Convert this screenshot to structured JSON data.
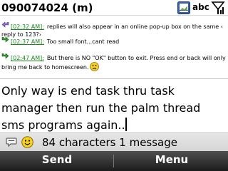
{
  "header": {
    "title": "090074024 (m)",
    "mode_indicator": "abc"
  },
  "history": {
    "messages": [
      {
        "time": "[02:32 AM]:",
        "text": "replies will also appear in an online pop-up box on the same ‹ reply to 123?›",
        "direction": "incoming",
        "arrow_icon": "incoming-arrow-icon"
      },
      {
        "time": "[02:37 AM]:",
        "text": "Too small font...cant read",
        "direction": "outgoing",
        "arrow_icon": "outgoing-arrow-icon"
      },
      {
        "time": "[02:47 AM]:",
        "text": "But there is NO \"OK\" button to exit. Press end or back will only bring me back to homescreen.",
        "direction": "outgoing",
        "arrow_icon": "outgoing-arrow-icon",
        "trailing_icon": "frown-icon"
      }
    ]
  },
  "compose": {
    "text": "Only way is end task thru task manager then run the palm thread sms programs again.."
  },
  "status": {
    "char_info": "84 characters 1 message"
  },
  "softkeys": {
    "left": "Send",
    "right": "Menu"
  },
  "colors": {
    "timestamp": "#1a8a1a",
    "incoming_arrow": "#8a6fc8",
    "outgoing_arrow": "#2f9a2f",
    "softkey_bar": "#2a2a2a",
    "smiley": "#f5d020"
  }
}
